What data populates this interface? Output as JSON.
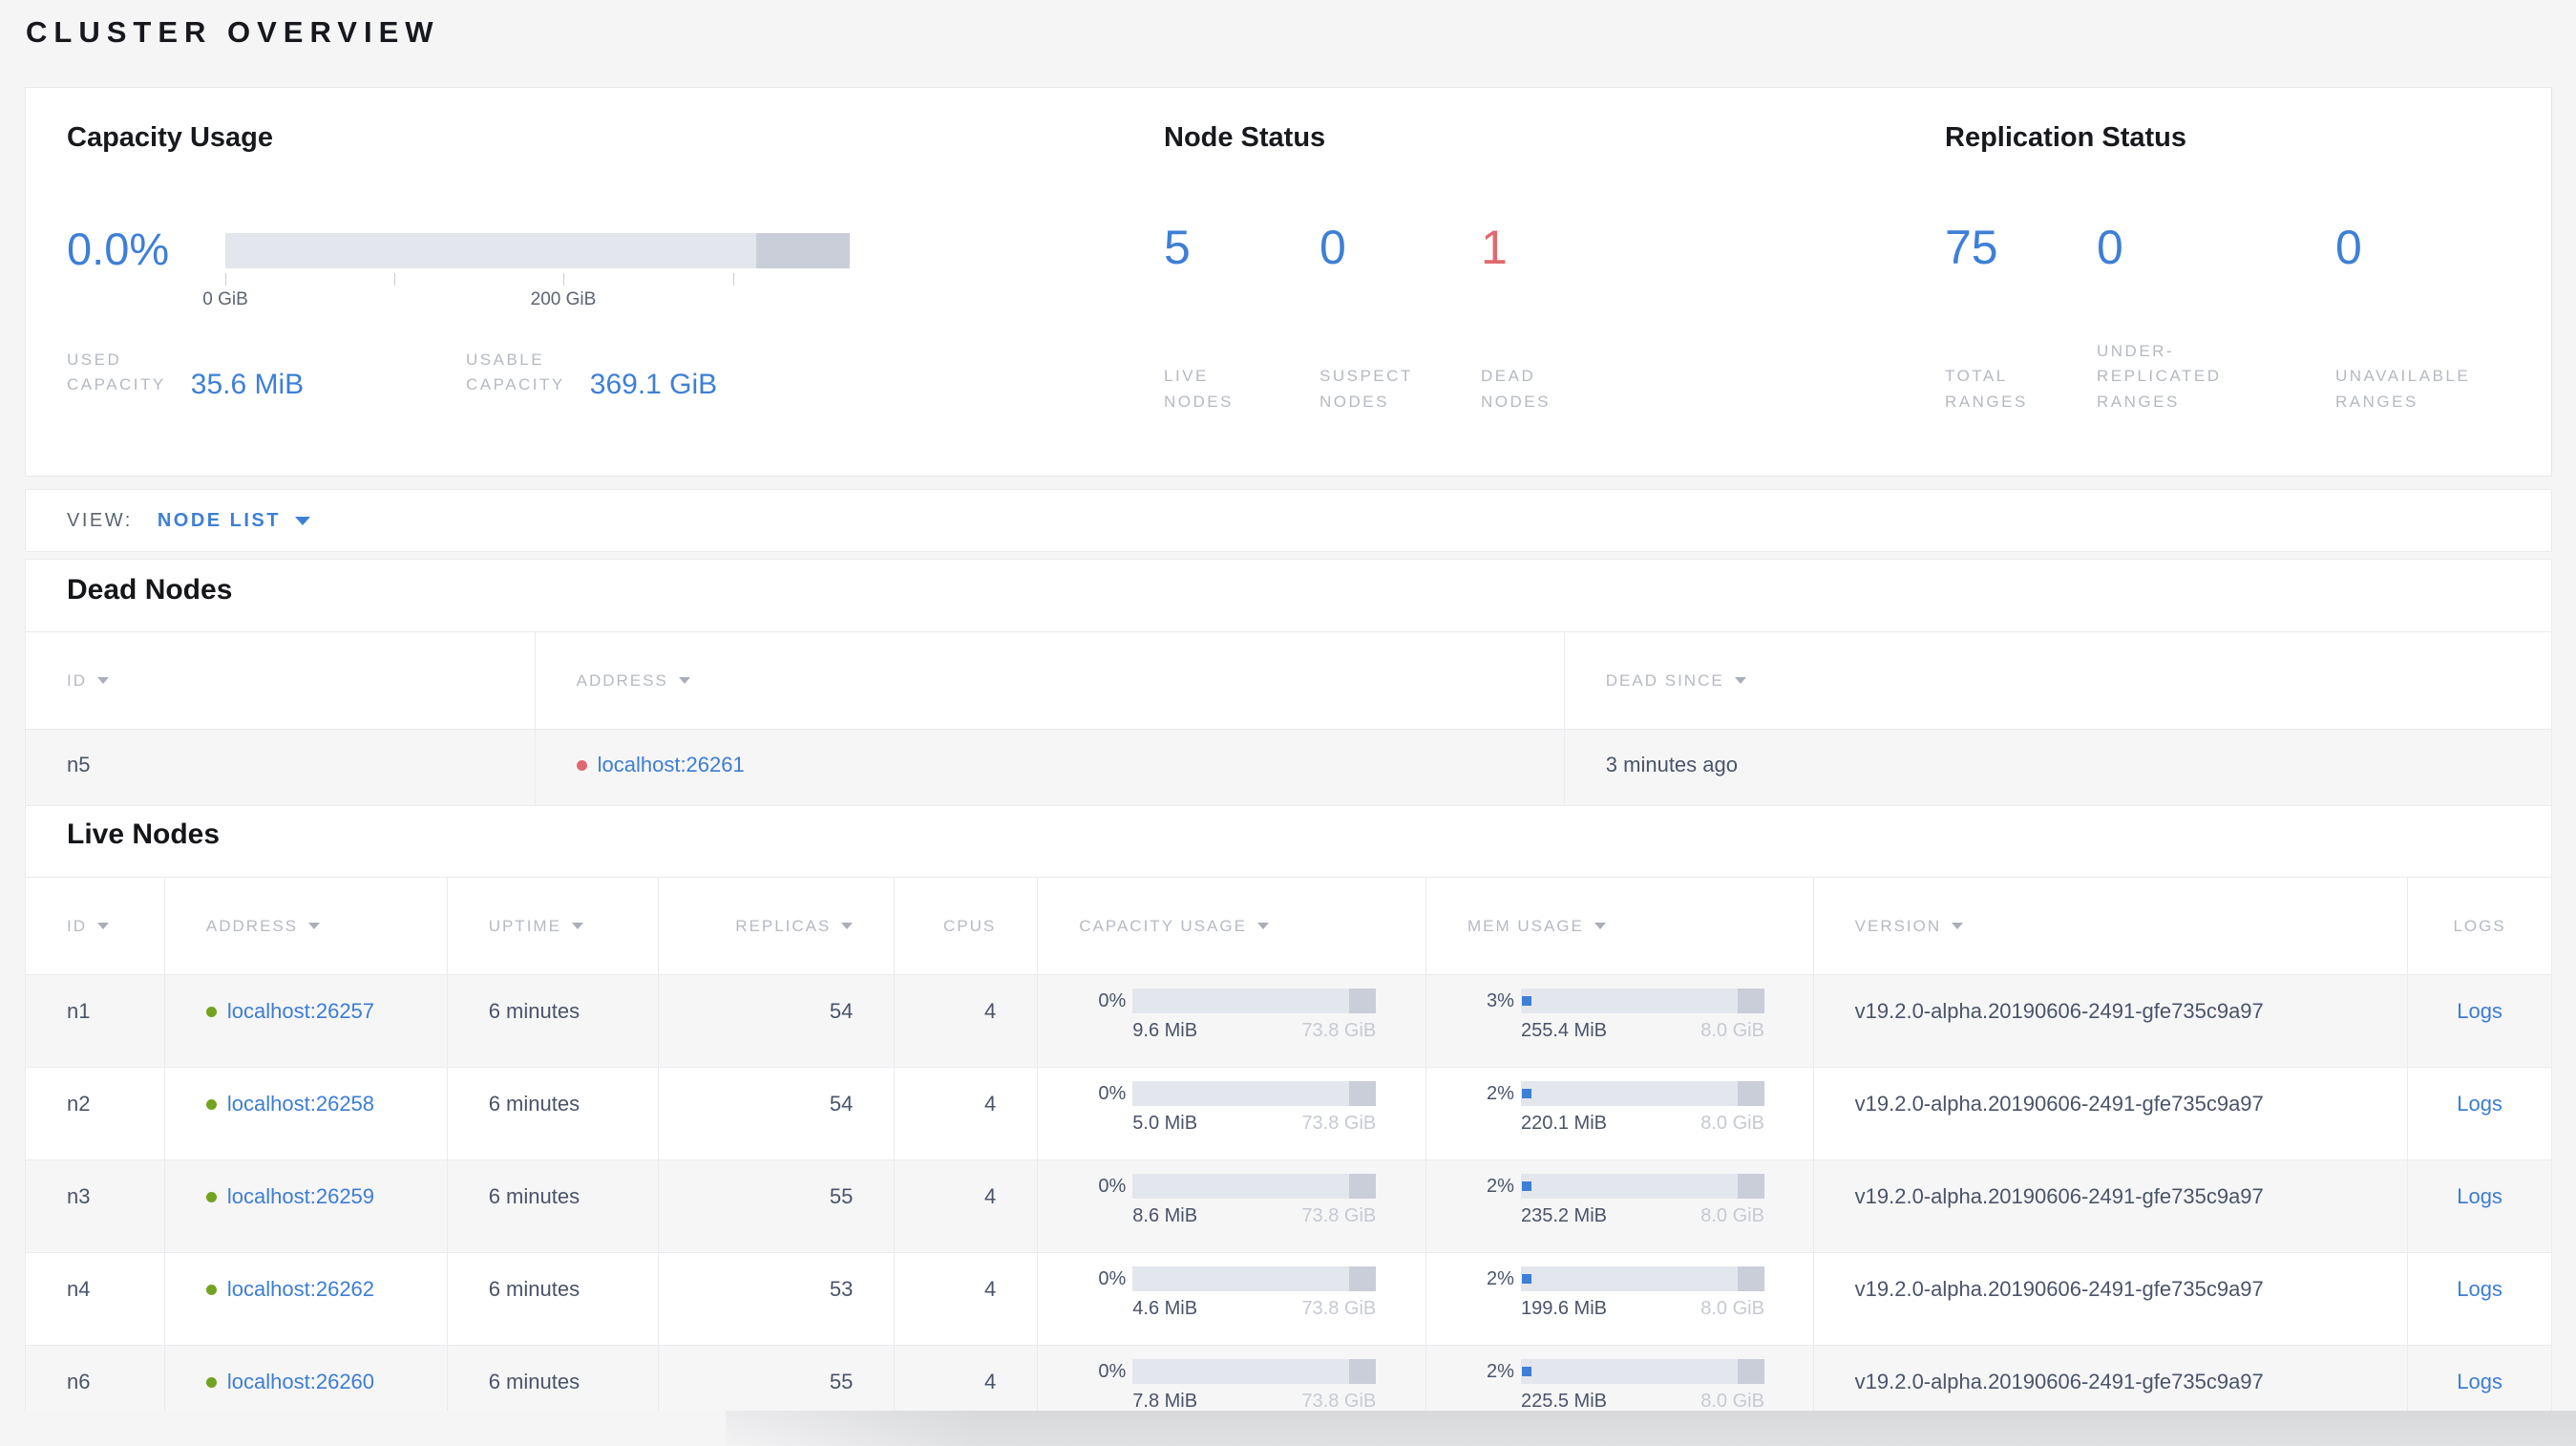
{
  "page": {
    "title": "CLUSTER OVERVIEW"
  },
  "colors": {
    "accent_blue": "#3e7fd6",
    "danger_red": "#e0696f",
    "live_green": "#72a321",
    "bar_light": "#e3e6ec",
    "bar_dark": "#caced9"
  },
  "summary": {
    "capacity": {
      "title": "Capacity Usage",
      "percent": "0.0%",
      "ticks": [
        "0 GiB",
        "200 GiB"
      ],
      "used": {
        "label": "USED\nCAPACITY",
        "value": "35.6 MiB"
      },
      "usable": {
        "label": "USABLE\nCAPACITY",
        "value": "369.1 GiB"
      }
    },
    "node_status": {
      "title": "Node Status",
      "stats": [
        {
          "value": "5",
          "label": "LIVE\nNODES"
        },
        {
          "value": "0",
          "label": "SUSPECT\nNODES"
        },
        {
          "value": "1",
          "label": "DEAD\nNODES"
        }
      ]
    },
    "replication": {
      "title": "Replication Status",
      "stats": [
        {
          "value": "75",
          "label": "TOTAL\nRANGES"
        },
        {
          "value": "0",
          "label": "UNDER-\nREPLICATED\nRANGES"
        },
        {
          "value": "0",
          "label": "UNAVAILABLE\nRANGES"
        }
      ]
    }
  },
  "view_bar": {
    "label": "VIEW:",
    "selected": "NODE LIST"
  },
  "dead_nodes": {
    "heading": "Dead Nodes",
    "columns": [
      "ID",
      "ADDRESS",
      "DEAD SINCE"
    ],
    "rows": [
      {
        "id": "n5",
        "address": "localhost:26261",
        "dead_since": "3 minutes ago"
      }
    ]
  },
  "live_nodes": {
    "heading": "Live Nodes",
    "columns": [
      "ID",
      "ADDRESS",
      "UPTIME",
      "REPLICAS",
      "CPUS",
      "CAPACITY USAGE",
      "MEM USAGE",
      "VERSION",
      "LOGS"
    ],
    "rows": [
      {
        "id": "n1",
        "address": "localhost:26257",
        "uptime": "6 minutes",
        "replicas": "54",
        "cpus": "4",
        "capacity": {
          "percent": "0%",
          "used": "9.6 MiB",
          "total": "73.8 GiB"
        },
        "mem": {
          "percent": "3%",
          "used": "255.4 MiB",
          "total": "8.0 GiB"
        },
        "version": "v19.2.0-alpha.20190606-2491-gfe735c9a97",
        "logs": "Logs"
      },
      {
        "id": "n2",
        "address": "localhost:26258",
        "uptime": "6 minutes",
        "replicas": "54",
        "cpus": "4",
        "capacity": {
          "percent": "0%",
          "used": "5.0 MiB",
          "total": "73.8 GiB"
        },
        "mem": {
          "percent": "2%",
          "used": "220.1 MiB",
          "total": "8.0 GiB"
        },
        "version": "v19.2.0-alpha.20190606-2491-gfe735c9a97",
        "logs": "Logs"
      },
      {
        "id": "n3",
        "address": "localhost:26259",
        "uptime": "6 minutes",
        "replicas": "55",
        "cpus": "4",
        "capacity": {
          "percent": "0%",
          "used": "8.6 MiB",
          "total": "73.8 GiB"
        },
        "mem": {
          "percent": "2%",
          "used": "235.2 MiB",
          "total": "8.0 GiB"
        },
        "version": "v19.2.0-alpha.20190606-2491-gfe735c9a97",
        "logs": "Logs"
      },
      {
        "id": "n4",
        "address": "localhost:26262",
        "uptime": "6 minutes",
        "replicas": "53",
        "cpus": "4",
        "capacity": {
          "percent": "0%",
          "used": "4.6 MiB",
          "total": "73.8 GiB"
        },
        "mem": {
          "percent": "2%",
          "used": "199.6 MiB",
          "total": "8.0 GiB"
        },
        "version": "v19.2.0-alpha.20190606-2491-gfe735c9a97",
        "logs": "Logs"
      },
      {
        "id": "n6",
        "address": "localhost:26260",
        "uptime": "6 minutes",
        "replicas": "55",
        "cpus": "4",
        "capacity": {
          "percent": "0%",
          "used": "7.8 MiB",
          "total": "73.8 GiB"
        },
        "mem": {
          "percent": "2%",
          "used": "225.5 MiB",
          "total": "8.0 GiB"
        },
        "version": "v19.2.0-alpha.20190606-2491-gfe735c9a97",
        "logs": "Logs"
      }
    ]
  }
}
